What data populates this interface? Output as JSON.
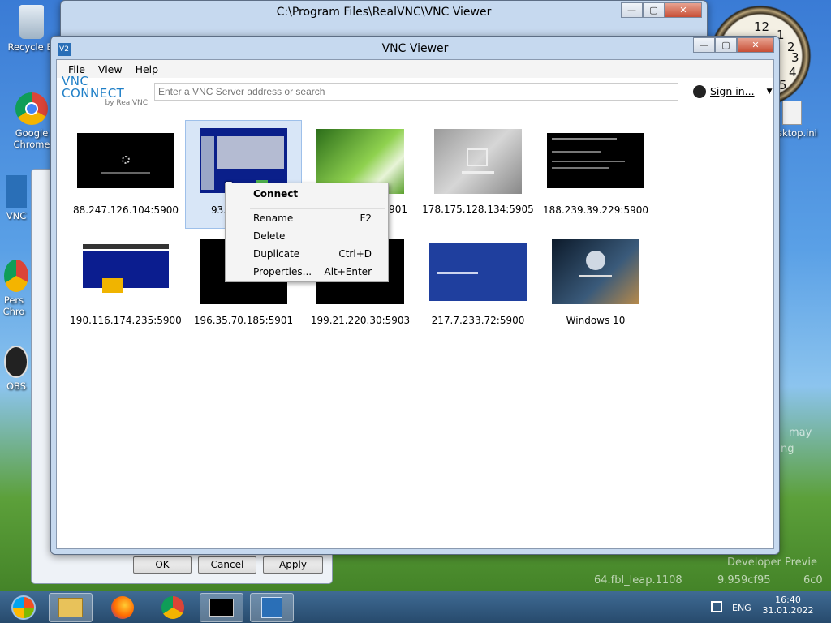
{
  "desktop": {
    "icons": [
      {
        "label": "Recycle Bi",
        "icon": "recycle-bin-icon"
      },
      {
        "label": "Google Chrome",
        "icon": "chrome-icon"
      },
      {
        "label": "VNC",
        "icon": "vnc-icon"
      },
      {
        "label": "Pers Chro",
        "icon": "chrome-icon"
      },
      {
        "label": "OBS",
        "icon": "obs-icon"
      },
      {
        "label": "sktop.ini",
        "icon": "file-icon"
      }
    ],
    "clock_numbers": [
      "12",
      "1",
      "2",
      "3",
      "4",
      "5"
    ],
    "watermark": [
      "may",
      "ng",
      "Developer Previe",
      "64.fbl_leap.1108",
      "9.959cf95",
      "6c0"
    ]
  },
  "explorer_window": {
    "title": "C:\\Program Files\\RealVNC\\VNC Viewer",
    "controls": [
      "—",
      "▢",
      "✕"
    ]
  },
  "dialog_window": {
    "buttons": {
      "ok": "OK",
      "cancel": "Cancel",
      "apply": "Apply"
    }
  },
  "vnc_window": {
    "title": "VNC Viewer",
    "app_icon": "V2",
    "controls": [
      "—",
      "▢",
      "✕"
    ],
    "menu": [
      "File",
      "View",
      "Help"
    ],
    "logo": {
      "line1": "VNC CONNECT",
      "line2": "by RealVNC"
    },
    "search": {
      "placeholder": "Enter a VNC Server address or search",
      "value": ""
    },
    "sign_in": "Sign in...",
    "connections": [
      {
        "label": "88.247.126.104:5900",
        "thumb": "black-loading"
      },
      {
        "label": "93.4",
        "thumb": "blue-desktop",
        "selected": true
      },
      {
        "label": "901",
        "thumb": "green-xp"
      },
      {
        "label": "178.175.128.134:5905",
        "thumb": "grey-login"
      },
      {
        "label": "188.239.39.229:5900",
        "thumb": "black-console"
      },
      {
        "label": "190.116.174.235:5900",
        "thumb": "web-page"
      },
      {
        "label": "196.35.70.185:5901",
        "thumb": "black"
      },
      {
        "label": "199.21.220.30:5903",
        "thumb": "black"
      },
      {
        "label": "217.7.233.72:5900",
        "thumb": "blue-screen"
      },
      {
        "label": "Windows 10",
        "thumb": "win10-lock"
      }
    ],
    "context_menu": [
      {
        "label": "Connect",
        "shortcut": "",
        "bold": true
      },
      {
        "label": "Rename",
        "shortcut": "F2"
      },
      {
        "label": "Delete",
        "shortcut": ""
      },
      {
        "label": "Duplicate",
        "shortcut": "Ctrl+D"
      },
      {
        "label": "Properties...",
        "shortcut": "Alt+Enter"
      }
    ]
  },
  "taskbar": {
    "apps": [
      "start-orb-icon",
      "explorer-icon",
      "firefox-icon",
      "chrome-icon",
      "cmd-icon",
      "vnc-icon"
    ],
    "language": "ENG",
    "time": "16:40",
    "date": "31.01.2022"
  },
  "colors": {
    "accent": "#1f7fc7",
    "selection": "#d8e6f7",
    "titlebar": "#c6d9ef"
  }
}
